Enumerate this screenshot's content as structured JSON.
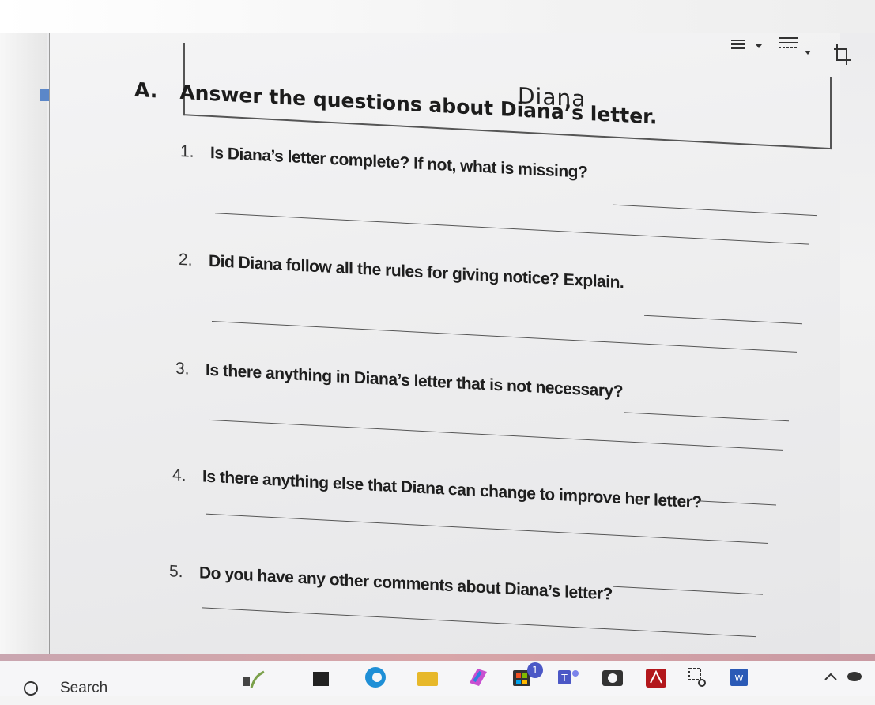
{
  "document": {
    "student_name": "Diana",
    "section_letter": "A.",
    "section_title": "Answer the questions about Diana’s letter.",
    "questions": [
      {
        "number": "1.",
        "text": "Is Diana’s letter complete? If not, what is missing?"
      },
      {
        "number": "2.",
        "text": "Did Diana follow all the rules for giving notice? Explain."
      },
      {
        "number": "3.",
        "text": "Is there anything in Diana’s letter that is not necessary?"
      },
      {
        "number": "4.",
        "text": "Is there anything else that Diana can change to improve her letter?"
      },
      {
        "number": "5.",
        "text": "Do you have any other comments about Diana’s letter?"
      }
    ]
  },
  "toolbar": {
    "icons": [
      "align-icon",
      "dropdown-icon",
      "line-spacing-icon",
      "dropdown-icon",
      "crop-icon"
    ]
  },
  "taskbar": {
    "search_label": "Search",
    "notification_badge": "1",
    "apps": [
      "weather-icon",
      "file-explorer-icon",
      "edge-icon",
      "folder-icon",
      "copilot-icon",
      "store-icon",
      "teams-icon",
      "camera-icon",
      "acrobat-icon",
      "snipping-icon",
      "word-icon"
    ]
  },
  "colors": {
    "taskbar_accent": "#d8a5a8",
    "marker": "#5b87c9"
  }
}
